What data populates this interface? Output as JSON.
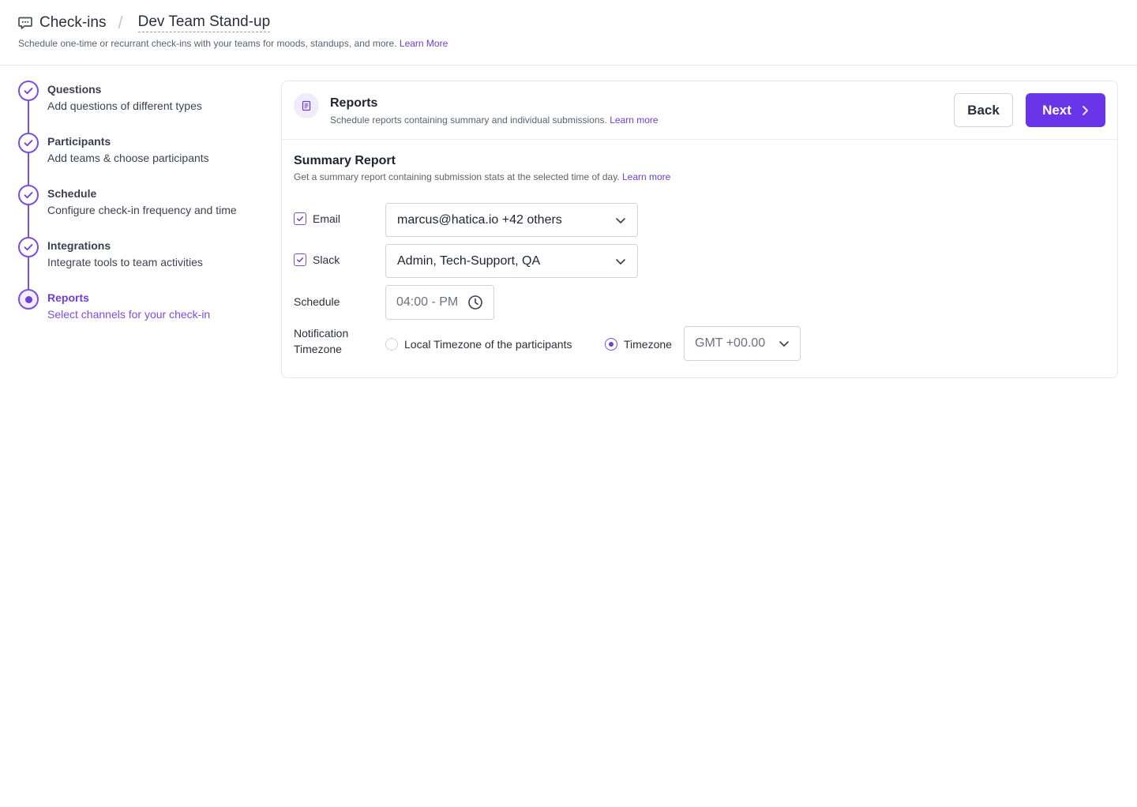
{
  "header": {
    "root_label": "Check-ins",
    "current_label": "Dev Team Stand-up",
    "subtitle": "Schedule one-time or recurrant check-ins with your teams for moods, standups, and more.",
    "learn_more": "Learn More",
    "icon": "chat-icon"
  },
  "steps": [
    {
      "title": "Questions",
      "desc": "Add questions of different types",
      "status": "done"
    },
    {
      "title": "Participants",
      "desc": "Add teams & choose participants",
      "status": "done"
    },
    {
      "title": "Schedule",
      "desc": "Configure check-in frequency and time",
      "status": "done"
    },
    {
      "title": "Integrations",
      "desc": "Integrate tools to team activities",
      "status": "done"
    },
    {
      "title": "Reports",
      "desc": "Select channels for your check-in",
      "status": "current"
    }
  ],
  "card": {
    "title": "Reports",
    "subtitle": "Schedule reports containing summary and individual submissions.",
    "learn_more": "Learn more",
    "back_label": "Back",
    "next_label": "Next",
    "icon": "document-icon"
  },
  "summary": {
    "title": "Summary Report",
    "subtitle": "Get a summary report containing submission stats at the selected time of day.",
    "learn_more": "Learn more",
    "email_label": "Email",
    "email_checked": true,
    "email_value": "marcus@hatica.io +42 others",
    "slack_label": "Slack",
    "slack_checked": true,
    "slack_value": "Admin, Tech-Support, QA",
    "schedule_label": "Schedule",
    "schedule_value": "04:00 - PM",
    "notif_line1": "Notification",
    "notif_line2": "Timezone",
    "local_tz_label": "Local Timezone of the participants",
    "tz_label": "Timezone",
    "tz_value": "GMT +00.00",
    "selected_tz_option": "Timezone"
  },
  "colors": {
    "accent": "#6a35e8",
    "link": "#6b3fd8",
    "border": "#cfd3da"
  }
}
